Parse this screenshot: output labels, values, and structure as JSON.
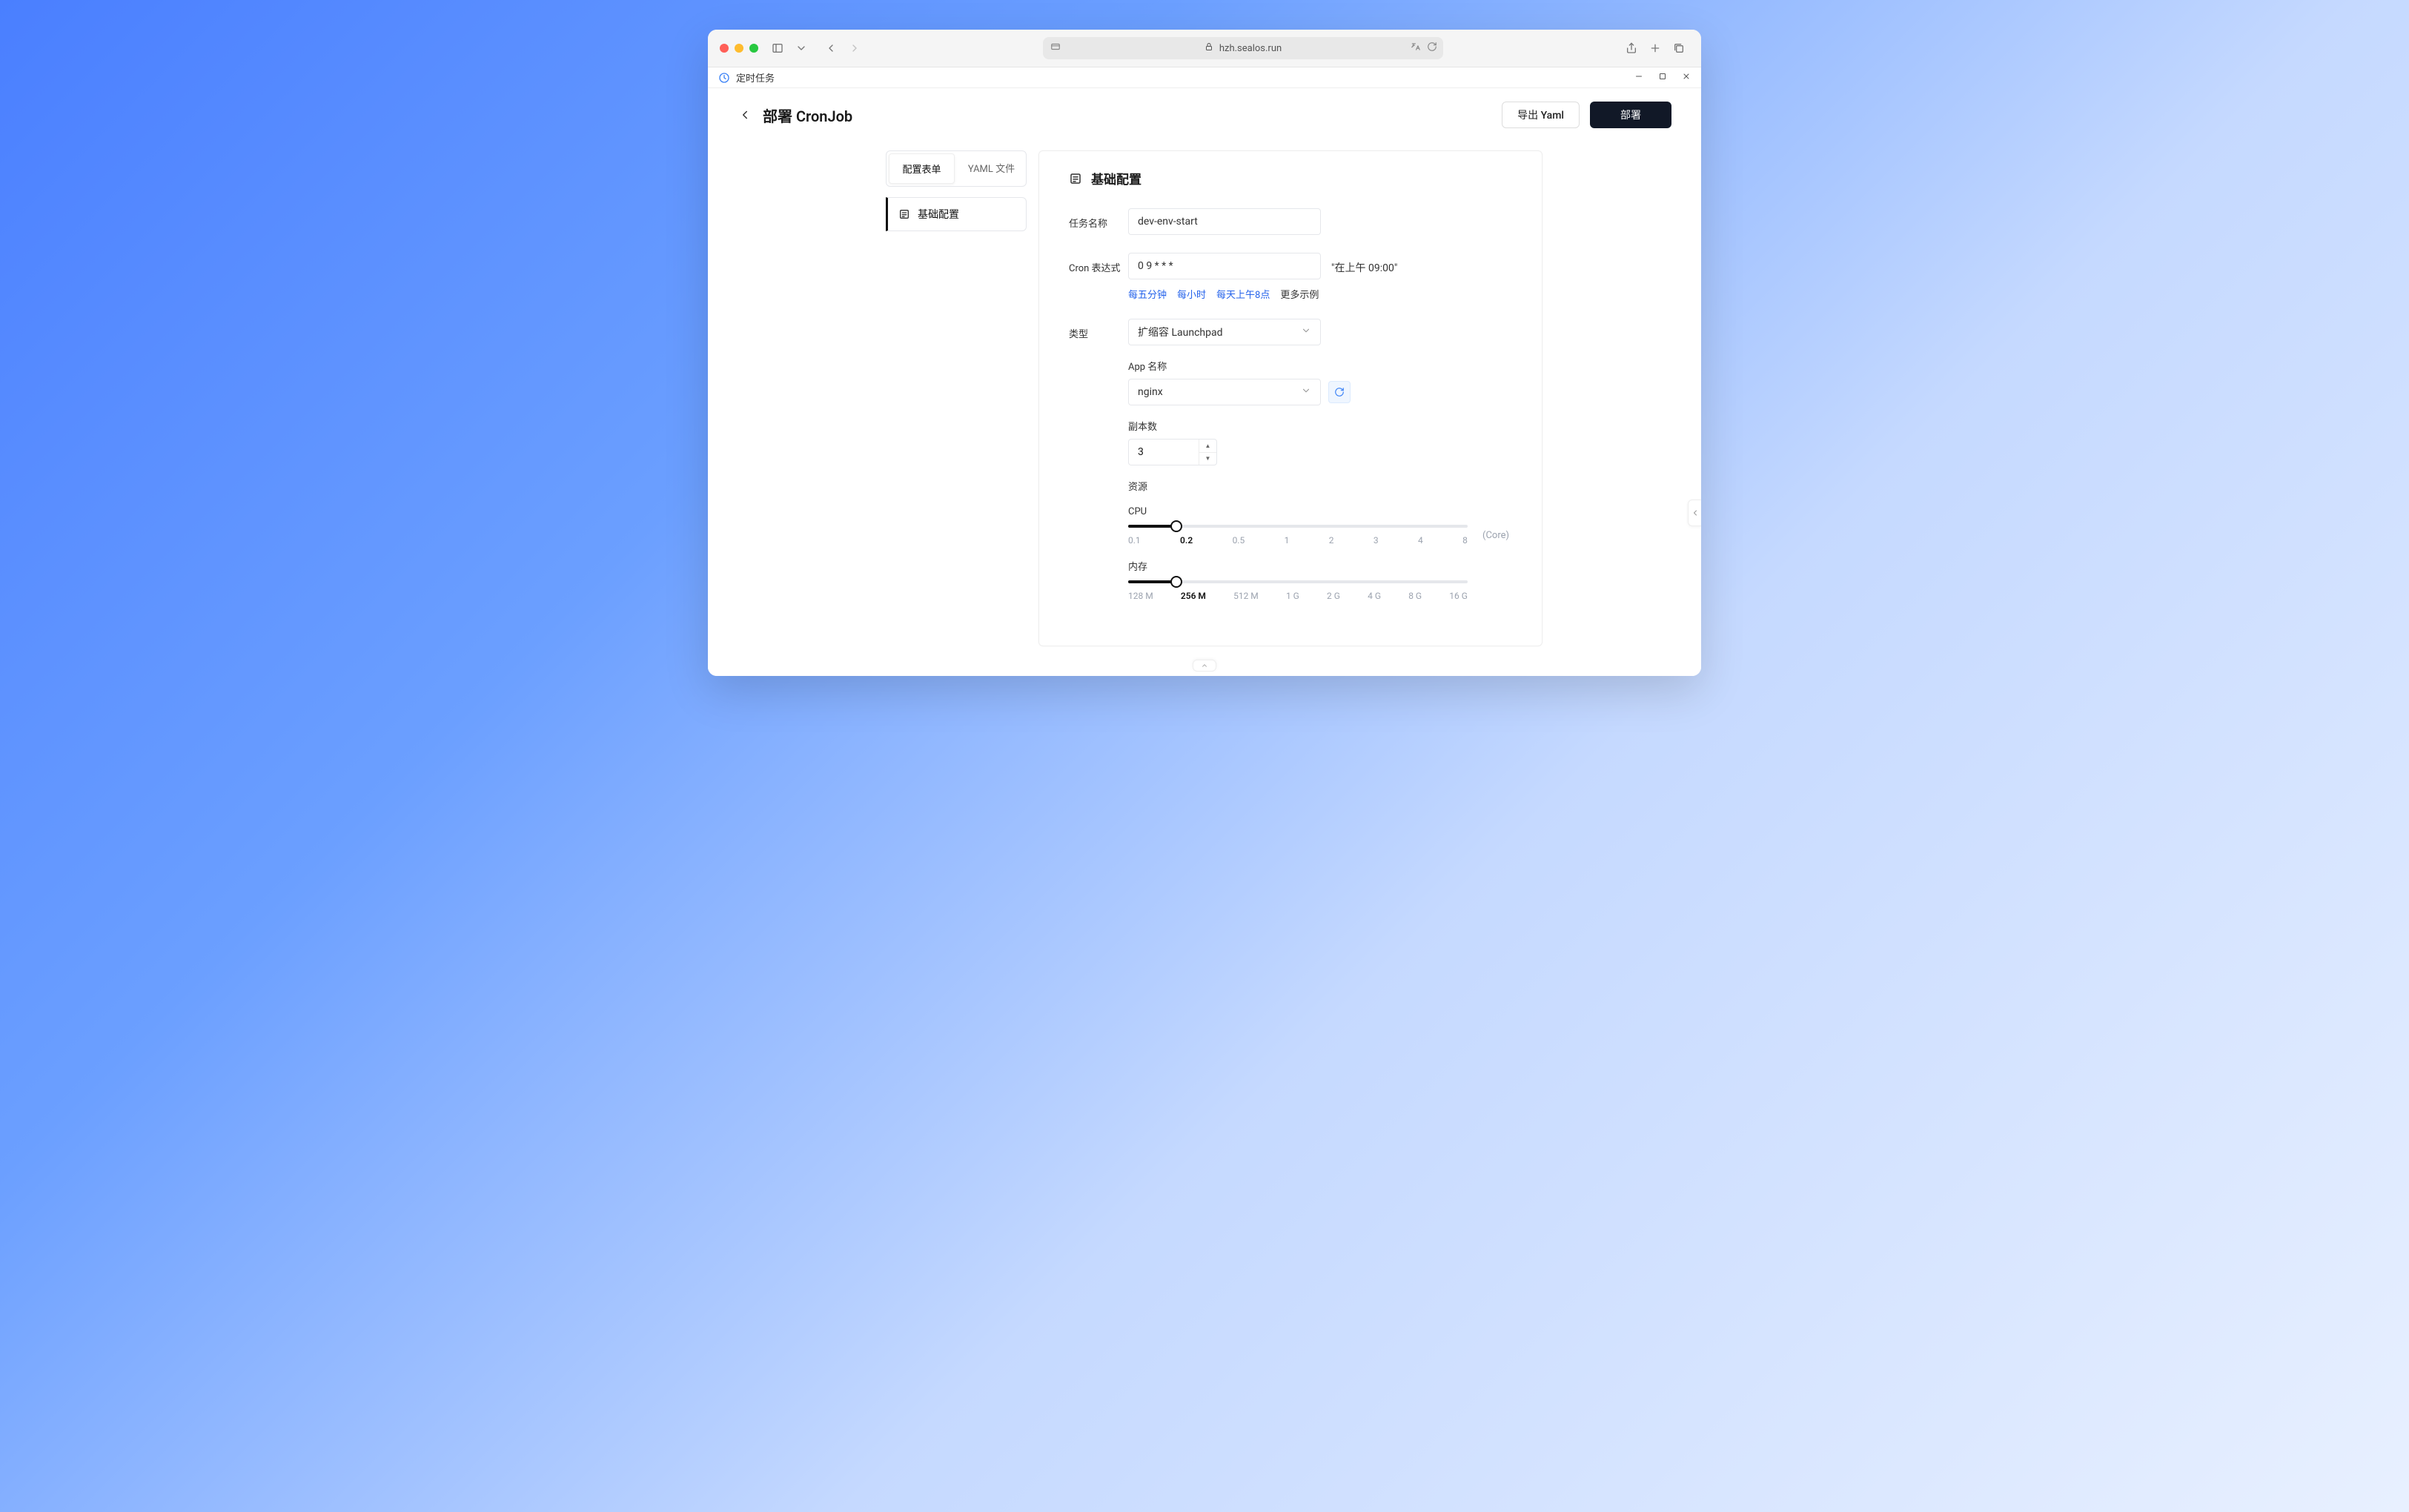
{
  "browser": {
    "url": "hzh.sealos.run"
  },
  "tab": {
    "title": "定时任务"
  },
  "header": {
    "title": "部署 CronJob",
    "export_yaml": "导出 Yaml",
    "deploy": "部署"
  },
  "sidebar": {
    "tabs": {
      "form": "配置表单",
      "yaml": "YAML 文件"
    },
    "nav": {
      "basic": "基础配置"
    }
  },
  "panel": {
    "title": "基础配置",
    "labels": {
      "task_name": "任务名称",
      "cron": "Cron 表达式",
      "type": "类型",
      "app_name": "App 名称",
      "replicas": "副本数",
      "resources": "资源",
      "cpu": "CPU",
      "memory": "内存"
    },
    "task_name_value": "dev-env-start",
    "cron_value": "0 9 * * *",
    "cron_preview": "\"在上午 09:00\"",
    "cron_hints": {
      "every5min": "每五分钟",
      "hourly": "每小时",
      "daily8am": "每天上午8点",
      "more": "更多示例"
    },
    "type_value": "扩缩容 Launchpad",
    "app_value": "nginx",
    "replicas_value": "3",
    "cpu": {
      "ticks": [
        "0.1",
        "0.2",
        "0.5",
        "1",
        "2",
        "3",
        "4",
        "8"
      ],
      "active_index": 1,
      "unit": "(Core)"
    },
    "memory": {
      "ticks": [
        "128 M",
        "256 M",
        "512 M",
        "1 G",
        "2 G",
        "4 G",
        "8 G",
        "16 G"
      ],
      "active_index": 1,
      "unit": ""
    }
  }
}
